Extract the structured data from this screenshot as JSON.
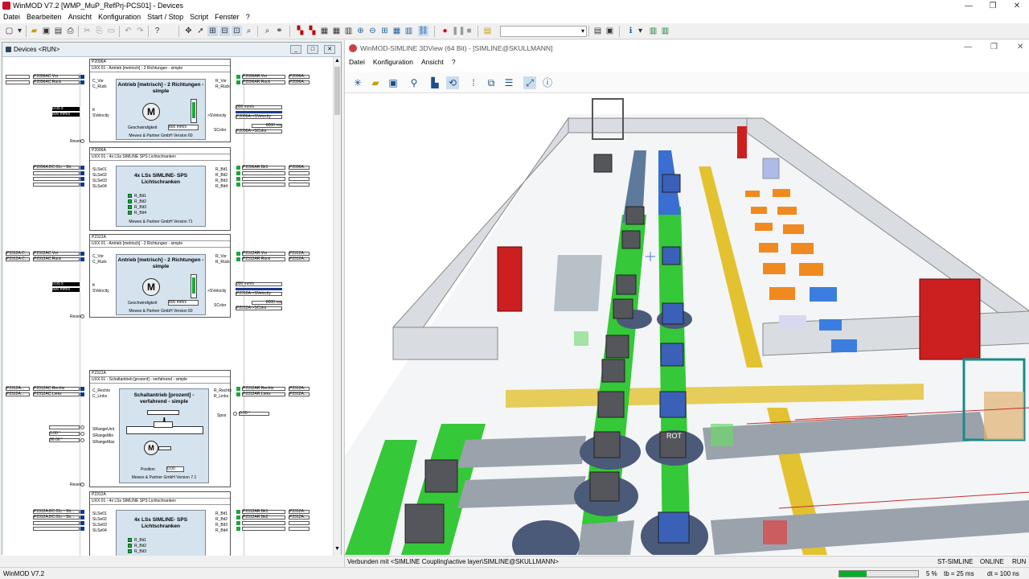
{
  "app": {
    "title": "WinMOD V7.2 [WMP_MuP_RefPrj-PCS01] - Devices",
    "menu": [
      "Datei",
      "Bearbeiten",
      "Ansicht",
      "Konfiguration",
      "Start / Stop",
      "Script",
      "Fenster",
      "?"
    ],
    "window_controls": {
      "minimize": "—",
      "maximize": "❐",
      "close": "✕"
    }
  },
  "devices_window": {
    "title": "Devices <RUN>",
    "blocks": [
      {
        "id": "P2096A",
        "type": "UXX 01 - Antrieb [metrisch] - 2 Richtungen - simple",
        "heading": "Antrieb [metrisch] - 2 Richtungen - simple",
        "footer": "Mewes & Partner GmbH Version 60",
        "speed_label": "Geschwindigkeit",
        "speed_value": "800 mm/s",
        "in_left": [
          "P2096AC.Vor",
          "P2096AC.Rück"
        ],
        "inputs": [
          "C_Vor",
          "C_Rück"
        ],
        "outputs": [
          "R_Vor",
          "R_Rück"
        ],
        "out_right": [
          "P2096AR.Vor",
          "P2096AR.Rück"
        ],
        "out_ext": [
          "P2096A...",
          "P2096A..."
        ],
        "sig1": "0.05 s",
        "sig2": "800 mm/s",
        "sig_names": [
          "tt",
          "SVelocity"
        ],
        "right_vals": [
          "800 mm/s",
          "P2096A->SVelocity",
          "8000 ms",
          "P2096A->SColor"
        ],
        "right_ports": [
          ">SVelocity",
          "SColor"
        ],
        "reset": "Reset"
      },
      {
        "id": "P2096A",
        "type": "UXX 01 - 4x LSs SIMLINE SPS Lichtschranken",
        "heading": "4x LSs SIMLINE- SPS Lichtschranken",
        "footer": "Mewes & Partner GmbH Version 71",
        "in_left": [
          "P2096A.BC.01c - Sti..."
        ],
        "ports_in": [
          "SLSe01",
          "SLSe02",
          "SLSe03",
          "SLSe04"
        ],
        "leds": [
          "R_Bit1",
          "R_Bit2",
          "R_Bit3",
          "R_Bit4"
        ],
        "ports_out": [
          "R_Bit1",
          "R_Bit2",
          "R_Bit3",
          "R_Bit4"
        ],
        "out_right": [
          "P2096AR.Bit1"
        ],
        "out_ext": [
          "P2096A..."
        ]
      },
      {
        "id": "P2312A",
        "type": "UXX 01 - Antrieb [metrisch] - 2 Richtungen - simple",
        "heading": "Antrieb [metrisch] - 2 Richtungen - simple",
        "footer": "Mewes & Partner GmbH Version 60",
        "speed_label": "Geschwindigkeit",
        "speed_value": "800 mm/s",
        "in_left": [
          "P2312AC.Vor",
          "P2312AC.Rück"
        ],
        "in_ext": [
          "P2312A.C...",
          "P2312A.C..."
        ],
        "inputs": [
          "C_Vor",
          "C_Rück"
        ],
        "outputs": [
          "R_Vor",
          "R_Rück"
        ],
        "out_right": [
          "P2312AR.Vor",
          "P2312AR.Rück"
        ],
        "out_ext": [
          "P2312A...",
          "P2312A..."
        ],
        "sig1": "0.05 s",
        "sig2": "800 mm/s",
        "sig_names": [
          "tt",
          "SVelocity"
        ],
        "right_vals": [
          "800 mm/s",
          "P2312A->SVelocity",
          "8000 ms",
          "P2312A->SColor"
        ],
        "right_ports": [
          ">SVelocity",
          "SColor"
        ],
        "reset": "Reset"
      },
      {
        "id": "P2312A",
        "type": "UXX 01 - Schaltantrieb [prozent] - verfahrend - simple",
        "heading": "Schaltantrieb [prozent] - verfahrend - simple",
        "footer": "Mewes & Partner GmbH Version 7.1",
        "in_left": [
          "P2312AC.Rechts",
          "P2312AC.Links"
        ],
        "in_ext": [
          "P2312A...",
          "P2312A..."
        ],
        "inputs": [
          "C_Rechts",
          "C_Links"
        ],
        "outputs": [
          "R_Rechts",
          "R_Links"
        ],
        "out_right": [
          "P2312AR.Rechts",
          "P2312AR.Links"
        ],
        "out_ext": [
          "P2312A...",
          "P2312A..."
        ],
        "range_ports": [
          "SRangeUnit",
          "SRangeMin",
          "SRangeMax"
        ],
        "range_vals": [
          "0.00 °",
          "90.00 °"
        ],
        "pos_label": "Position",
        "pos_value": "0.00",
        "spos_port": "Spos",
        "spos_value": "0.00 °",
        "reset": "Reset"
      },
      {
        "id": "P2312A",
        "type": "UXX 01 - 4x LSs SIMLINE SPS Lichtschranken",
        "heading": "4x LSs SIMLINE- SPS Lichtschranken",
        "in_left": [
          "P2312A.BC.01c - Sti...",
          "P2312A.BC.01c - Sti..."
        ],
        "ports_in": [
          "SLSe01",
          "SLSe02",
          "SLSe03",
          "SLSe04"
        ],
        "leds": [
          "R_Bit1",
          "R_Bit2",
          "R_Bit3"
        ],
        "ports_out": [
          "R_Bit1",
          "R_Bit2",
          "R_Bit3",
          "R_Bit4"
        ],
        "out_right": [
          "P2312AR.Bit1",
          "P2312AR.Bit2"
        ],
        "out_ext": [
          "P2312A...",
          "P2312A..."
        ]
      }
    ]
  },
  "sim_window": {
    "title": "WinMOD-SIMLINE 3DView (64 Bit) - [SIMLINE@SKULLMANN]",
    "menu": [
      "Datei",
      "Konfiguration",
      "Ansicht",
      "?"
    ],
    "scene_labels": [
      "ROT"
    ],
    "status": {
      "left": "Verbunden mit <SIMLINE Coupling\\active layer\\SIMLINE@SKULLMANN>",
      "mode": "ST-SIMLINE",
      "online": "ONLINE",
      "run": "RUN"
    }
  },
  "statusbar": {
    "left": "WinMOD V7.2",
    "progress": 0.35,
    "percent": "5 %",
    "tb": "tb = 25 ms",
    "dt": "dt = 100 ns"
  }
}
